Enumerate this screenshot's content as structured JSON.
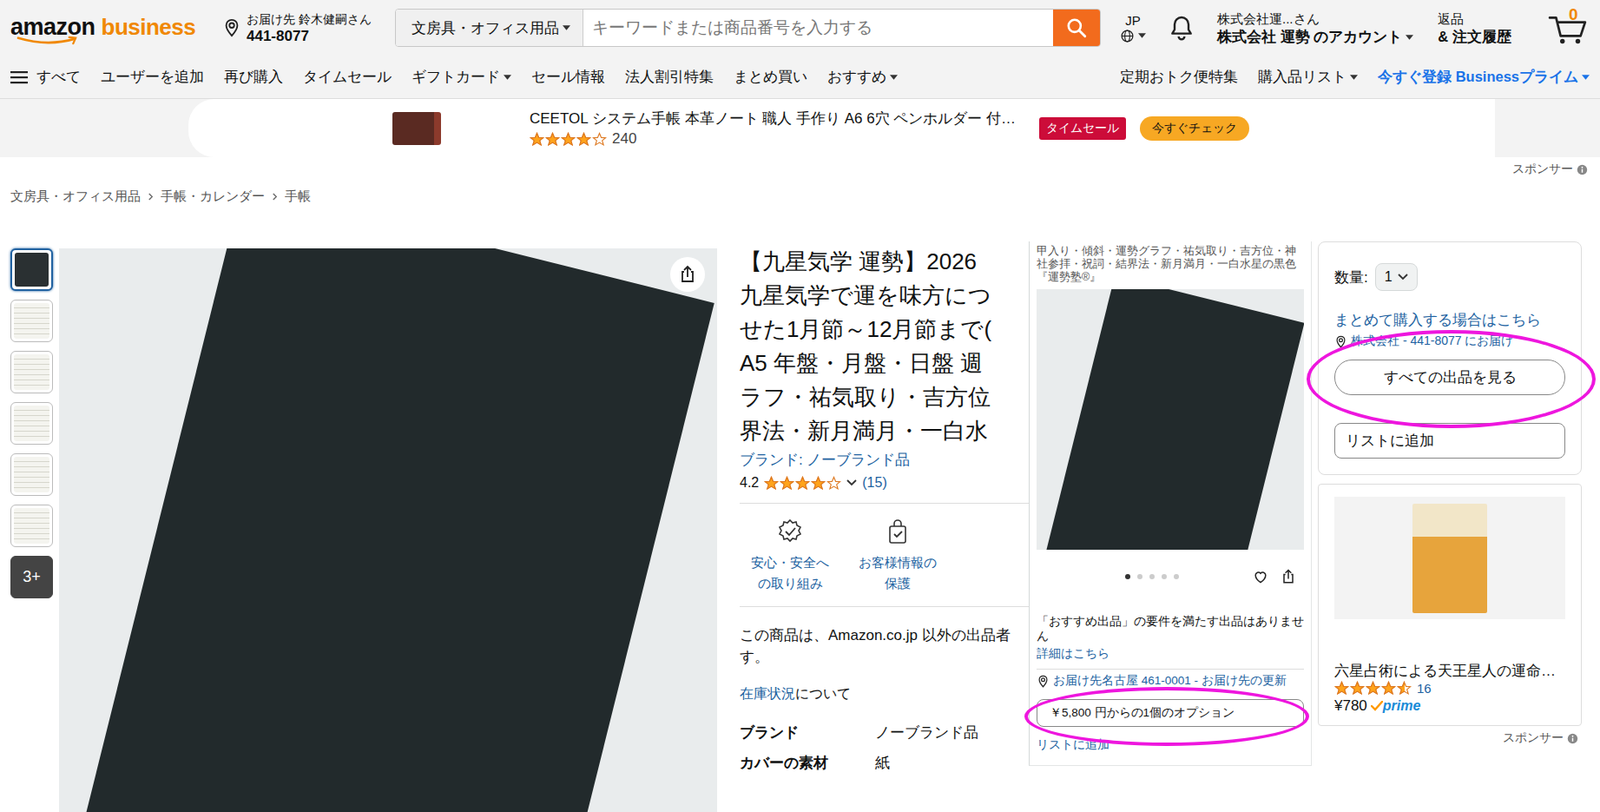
{
  "header": {
    "logo": {
      "brand": "amazon",
      "sub": "business"
    },
    "location": {
      "label": "お届け先 鈴木健嗣さん",
      "postal": "441-8077"
    },
    "search": {
      "category": "文房具・オフィス用品",
      "placeholder": "キーワードまたは商品番号を入力する"
    },
    "language": "JP",
    "account": {
      "line1": "株式会社運...さん",
      "line2": "株式会社 運勢 のアカウント"
    },
    "orders": {
      "line1": "返品",
      "line2": "& 注文履歴"
    },
    "cart": {
      "count": "0"
    }
  },
  "nav": {
    "menu_label": "すべて",
    "items": [
      {
        "label": "ユーザーを追加",
        "dropdown": false,
        "emphasized": false
      },
      {
        "label": "再び購入",
        "dropdown": false,
        "emphasized": false
      },
      {
        "label": "タイムセール",
        "dropdown": false,
        "emphasized": false
      },
      {
        "label": "ギフトカード",
        "dropdown": true,
        "emphasized": false
      },
      {
        "label": "セール情報",
        "dropdown": false,
        "emphasized": false
      },
      {
        "label": "法人割引特集",
        "dropdown": false,
        "emphasized": false
      },
      {
        "label": "まとめ買い",
        "dropdown": false,
        "emphasized": false
      },
      {
        "label": "おすすめ",
        "dropdown": true,
        "emphasized": false
      }
    ],
    "right_items": [
      {
        "label": "定期おトク便特集",
        "dropdown": false,
        "emphasized": false
      },
      {
        "label": "購入品リスト",
        "dropdown": true,
        "emphasized": false
      },
      {
        "label": "今すぐ登録 Businessプライム",
        "dropdown": true,
        "emphasized": true
      }
    ]
  },
  "banner": {
    "title": "CEETOL システム手帳 本革ノート 職人 手作り A6 6穴 ペンホルダー 付…",
    "stars": 4,
    "rating_count": "240",
    "badge": "タイムセール",
    "button": "今すぐチェック",
    "sponsor_label": "スポンサー"
  },
  "breadcrumb": [
    "文房具・オフィス用品",
    "手帳・カレンダー",
    "手帳"
  ],
  "gallery": {
    "thumbnails": [
      {
        "selected": true
      },
      {
        "selected": false
      },
      {
        "selected": false
      },
      {
        "selected": false
      },
      {
        "selected": false
      },
      {
        "selected": false
      }
    ],
    "more": "3+"
  },
  "product": {
    "title_lines": [
      "【九星気学 運勢】2026",
      "九星気学で運を味方につ",
      "せた1月節～12月節まで(",
      "A5 年盤・月盤・日盤 週",
      "ラフ・祐気取り・吉方位",
      "界法・新月満月・一白水"
    ],
    "brand": "ブランド: ノーブランド品",
    "rating": "4.2",
    "stars": 4,
    "rating_count": "(15)",
    "features": [
      {
        "label": "安心・安全への取り組み",
        "kind": "safety"
      },
      {
        "label": "お客様情報の保護",
        "kind": "privacy"
      }
    ],
    "seller_note": [
      "この商品は、Amazon.co.jp 以外の出品者",
      "す。"
    ],
    "stock_link": "在庫状況",
    "stock_suffix": "について",
    "specs": [
      {
        "label": "ブランド",
        "value": "ノーブランド品"
      },
      {
        "label": "カバーの素材",
        "value": "紙"
      }
    ]
  },
  "popup": {
    "caption": "甲入り・傾斜・運勢グラフ・祐気取り・吉方位・神社参拝・祝詞・結界法・新月満月・一白水星の黒色『運勢塾®』",
    "image_dots": [
      {
        "selected": true
      },
      {
        "selected": false
      },
      {
        "selected": false
      },
      {
        "selected": false
      },
      {
        "selected": false
      }
    ],
    "notice": "「おすすめ出品」の要件を満たす出品はありません",
    "details_link": "詳細はこちら",
    "location": "お届け先名古屋 461-0001 - お届け先の更新",
    "offer_button": {
      "label": "￥5,800 円からの1個のオプション",
      "highlighted": true
    },
    "list_link": "リストに追加"
  },
  "buy_box": {
    "quantity_label": "数量:",
    "quantity": "1",
    "bulk_link": "まとめて購入する場合はこちら",
    "location": "株式会社 - 441-8077 にお届け",
    "all_offers_button": {
      "label": "すべての出品を見る",
      "highlighted": true
    },
    "add_to_list": "リストに追加"
  },
  "ad_card": {
    "title": "六星占術による天王星人の運命…",
    "stars": 4.5,
    "rating_count": "16",
    "price": "¥780",
    "prime": "prime",
    "sponsor_label": "スポンサー"
  }
}
